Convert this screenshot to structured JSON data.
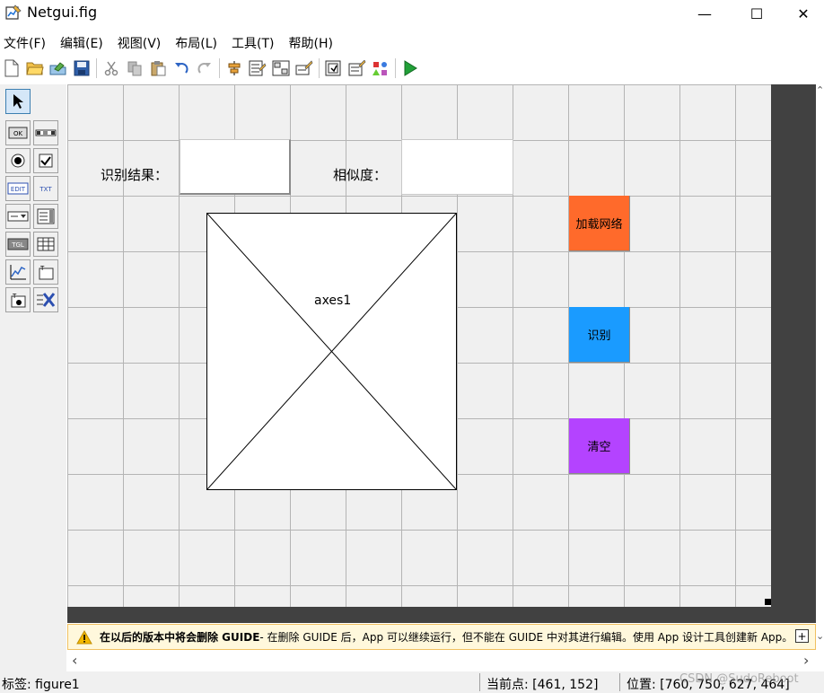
{
  "window": {
    "title": "Netgui.fig",
    "minimize_glyph": "—",
    "maximize_glyph": "☐",
    "close_glyph": "✕"
  },
  "menu": [
    "文件(F)",
    "编辑(E)",
    "视图(V)",
    "布局(L)",
    "工具(T)",
    "帮助(H)"
  ],
  "toolbar": {
    "icons": [
      "new-file-icon",
      "open-folder-icon",
      "save-as-icon",
      "save-icon",
      "cut-icon",
      "copy-icon",
      "paste-icon",
      "undo-icon",
      "redo-icon",
      "align-icon",
      "menu-editor-icon",
      "tab-order-icon",
      "toolbar-editor-icon",
      "editor-icon",
      "property-inspector-icon",
      "object-browser-icon",
      "run-icon"
    ]
  },
  "palette": {
    "items": [
      {
        "name": "select-tool",
        "label": ""
      },
      {
        "name": "push-button-tool",
        "label": "OK"
      },
      {
        "name": "slider-tool",
        "label": ""
      },
      {
        "name": "radio-button-tool",
        "label": ""
      },
      {
        "name": "checkbox-tool",
        "label": ""
      },
      {
        "name": "edit-text-tool",
        "label": "EDIT"
      },
      {
        "name": "static-text-tool",
        "label": "TXT"
      },
      {
        "name": "popup-menu-tool",
        "label": ""
      },
      {
        "name": "listbox-tool",
        "label": ""
      },
      {
        "name": "toggle-button-tool",
        "label": "TGL"
      },
      {
        "name": "table-tool",
        "label": ""
      },
      {
        "name": "axes-tool",
        "label": ""
      },
      {
        "name": "panel-tool",
        "label": ""
      },
      {
        "name": "button-group-tool",
        "label": ""
      },
      {
        "name": "activex-tool",
        "label": ""
      }
    ]
  },
  "canvas": {
    "result_label": "识别结果：",
    "similarity_label": "相似度：",
    "axes_label": "axes1",
    "buttons": [
      {
        "label": "加载网络",
        "color": "#ff6a2b"
      },
      {
        "label": "识别",
        "color": "#1a9bff"
      },
      {
        "label": "清空",
        "color": "#b443ff"
      }
    ]
  },
  "warning": {
    "bold_text": "在以后的版本中将会删除 GUIDE",
    "text": " - 在删除 GUIDE 后，App 可以继续运行，但不能在 GUIDE 中对其进行编辑。使用 App 设计工具创建新 App。",
    "expand_glyph": "+"
  },
  "scroll": {
    "up": "⌃",
    "down": "⌄",
    "left": "‹",
    "right": "›"
  },
  "status": {
    "tag": "标签: figure1",
    "current_point": "当前点:  [461, 152]",
    "position": "位置: [760, 750, 627, 464]",
    "watermark": "CSDN @SudoReboot"
  },
  "colors": {
    "grid_bg": "#f0f0f0",
    "dark_margin": "#414141",
    "warning_bg": "#fff8dc"
  }
}
